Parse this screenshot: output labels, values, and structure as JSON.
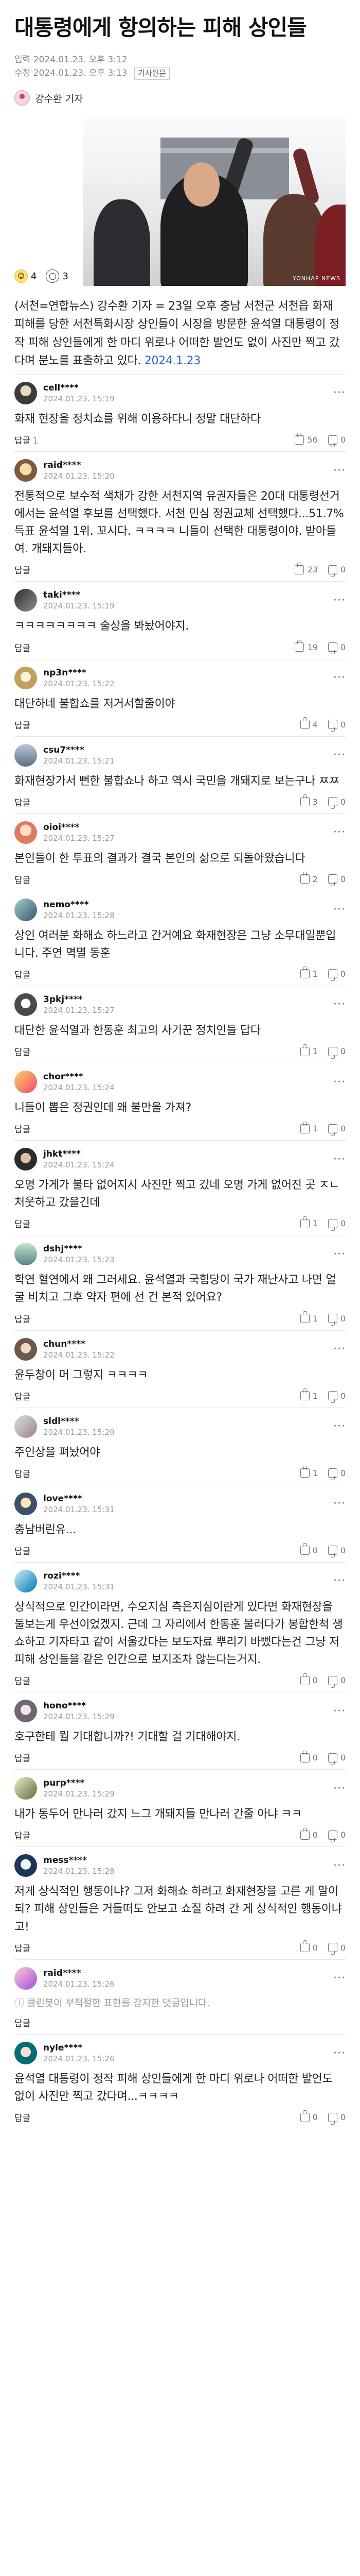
{
  "article": {
    "headline": "대통령에게 항의하는 피해 상인들",
    "published": "입력 2024.01.23. 오후 3:12",
    "modified": "수정 2024.01.23. 오후 3:13",
    "original_label": "기사원문",
    "reporter": "강수환 기자",
    "like_count": "4",
    "comment_count": "3",
    "photo_watermark": "YONHAP NEWS",
    "body_text": "(서천=연합뉴스) 강수환 기자 = 23일 오후 충남 서천군 서천읍 화재 피해를 당한 서천특화시장 상인들이 시장을 방문한 윤석열 대통령이 정작 피해 상인들에게 한 마디 위로나 어떠한 발언도 없이 사진만 찍고 갔다며 분노를 표출하고 있다. ",
    "body_date": "2024.1.23"
  },
  "labels": {
    "reply": "답글",
    "blocked_notice": "클린봇이 부적절한 표현을 감지한 댓글입니다."
  },
  "comments": [
    {
      "nick": "cell****",
      "time": "2024.01.23. 15:19",
      "text": "화재 현장을 정치쇼를 위해 이용하다니 정말 대단하다",
      "replies": "1",
      "up": "56",
      "down": "0"
    },
    {
      "nick": "raid****",
      "time": "2024.01.23. 15:20",
      "text": "전통적으로 보수적 색채가 강한 서천지역 유권자들은 20대 대통령선거에서는 윤석열 후보를 선택했다. 서천 민심 정권교체 선택했다...51.7% 득표 윤석열 1위. 꼬시다. ㅋㅋㅋㅋ 니들이 선택한 대통령이야. 받아들여. 개돼지들아.",
      "replies": "",
      "up": "23",
      "down": "0"
    },
    {
      "nick": "taki****",
      "time": "2024.01.23. 15:19",
      "text": "ㅋㅋㅋㅋㅋㅋㅋㅋ 술상을 봐놨어야지.",
      "replies": "",
      "up": "19",
      "down": "0"
    },
    {
      "nick": "np3n****",
      "time": "2024.01.23. 15:22",
      "text": "대단하네 불합쇼를 저거서할줄이야",
      "replies": "",
      "up": "4",
      "down": "0"
    },
    {
      "nick": "csu7****",
      "time": "2024.01.23. 15:21",
      "text": "화재현장가서 뻔한 불합쇼나 하고 역시 국민을 개돼지로 보는구나 ㅉㅉ",
      "replies": "",
      "up": "3",
      "down": "0"
    },
    {
      "nick": "oioi****",
      "time": "2024.01.23. 15:27",
      "text": "본인들이 한 투표의 결과가 결국 본인의 삶으로 되돌아왔습니다",
      "replies": "",
      "up": "2",
      "down": "0"
    },
    {
      "nick": "nemo****",
      "time": "2024.01.23. 15:28",
      "text": "상인 여러분 화해쇼 하느라고 간거예요 화재현장은 그냥 소무대일뿐입니다. 주연 멱멸 동훈",
      "replies": "",
      "up": "1",
      "down": "0"
    },
    {
      "nick": "3pkj****",
      "time": "2024.01.23. 15:27",
      "text": "대단한 윤석열과 한동훈 최고의 사기꾼 정치인들 답다",
      "replies": "",
      "up": "1",
      "down": "0"
    },
    {
      "nick": "chor****",
      "time": "2024.01.23. 15:24",
      "text": "니들이 뽑은 정권인데 왜 불만을 가져?",
      "replies": "",
      "up": "1",
      "down": "0"
    },
    {
      "nick": "jhkt****",
      "time": "2024.01.23. 15:24",
      "text": "오명 가게가 불타 없어지시 사진만 찍고 갔네 오명 가게 없어진 곳 ㅈㄴ 처웃하고 갔을긴데",
      "replies": "",
      "up": "1",
      "down": "0"
    },
    {
      "nick": "dshj****",
      "time": "2024.01.23. 15:23",
      "text": "학연 혈연에서 왜 그러세요. 윤석열과 국힘당이 국가 재난사고 나면 얼굴 비치고 그후 약자 편에 선 건 본적 있어요?",
      "replies": "",
      "up": "1",
      "down": "0"
    },
    {
      "nick": "chun****",
      "time": "2024.01.23. 15:22",
      "text": "윤두창이 머 그렇지 ㅋㅋㅋㅋ",
      "replies": "",
      "up": "1",
      "down": "0"
    },
    {
      "nick": "sldl****",
      "time": "2024.01.23. 15:20",
      "text": "주인상을 펴놨어야",
      "replies": "",
      "up": "1",
      "down": "0"
    },
    {
      "nick": "love****",
      "time": "2024.01.23. 15:31",
      "text": "충남버린유...",
      "replies": "",
      "up": "0",
      "down": "0"
    },
    {
      "nick": "rozi****",
      "time": "2024.01.23. 15:31",
      "text": "상식적으로 인간이라면, 수오지심 측은지심이란게 있다면 화재현장을 둘보는게 우선이었겠지. 근데 그 자리에서 한동훈 불러다가 봉합한척 생쇼하고 기자타고 같이 서울갔다는 보도자료 뿌리기 바뻤다는건 그냥 저 피해 상인들을 같은 인간으로 보지조차 않는다는거지.",
      "replies": "",
      "up": "0",
      "down": "0"
    },
    {
      "nick": "hono****",
      "time": "2024.01.23. 15:29",
      "text": "호구한테 뭘 기대합니까?! 기대할 걸 기대해야지.",
      "replies": "",
      "up": "0",
      "down": "0"
    },
    {
      "nick": "purp****",
      "time": "2024.01.23. 15:29",
      "text": "내가 동두어 만나러 갔지 느그 개돼지들 만나러 간줄 아냐 ㅋㅋ",
      "replies": "",
      "up": "0",
      "down": "0"
    },
    {
      "nick": "mess****",
      "time": "2024.01.23. 15:28",
      "text": "저게 상식적인 행동이냐? 그저 화해쇼 하려고 화재현장을 고른 게 말이되? 피해 상인들은 거들떠도 안보고 쇼질 하려 간 게 상식적인 행동이냐고!",
      "replies": "",
      "up": "0",
      "down": "0"
    },
    {
      "nick": "raid****",
      "time": "2024.01.23. 15:26",
      "text": "",
      "blocked": true,
      "replies": "",
      "up": "",
      "down": ""
    },
    {
      "nick": "nyle****",
      "time": "2024.01.23. 15:26",
      "text": "윤석열 대통령이 정작 피해 상인들에게 한 마디 위로나 어떠한 발언도 없이 사진만 찍고 갔다며...ㅋㅋㅋㅋ",
      "replies": "",
      "up": "0",
      "down": "0"
    }
  ]
}
